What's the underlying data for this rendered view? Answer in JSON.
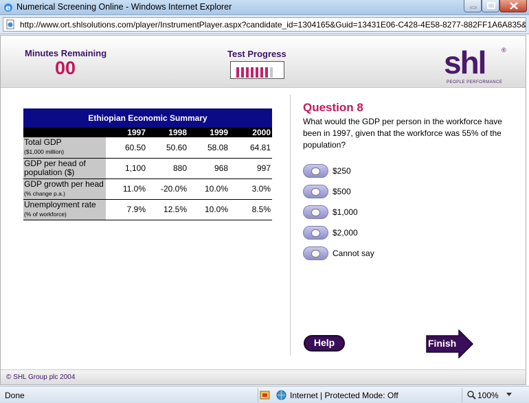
{
  "window": {
    "title": "Numerical Screening Online - Windows Internet Explorer",
    "url": "http://www.ort.shlsolutions.com/player/InstrumentPlayer.aspx?candidate_id=1304165&Guid=13431E06-C428-4E58-8277-882FF1A6A835&"
  },
  "header": {
    "minutes_label": "Minutes Remaining",
    "minutes_value": "00",
    "progress_label": "Test Progress",
    "progress_fraction": 0.875,
    "logo_text": "shl",
    "logo_reg": "®",
    "logo_tagline": "PEOPLE PERFORMANCE"
  },
  "table": {
    "caption": "Ethiopian Economic Summary",
    "years": [
      "1997",
      "1998",
      "1999",
      "2000"
    ],
    "rows": [
      {
        "label_main": "Total GDP",
        "label_sub": "($1,000 million)",
        "values": [
          "60.50",
          "50.60",
          "58.08",
          "64.81"
        ]
      },
      {
        "label_main": "GDP per head of population ($)",
        "label_sub": "",
        "values": [
          "1,100",
          "880",
          "968",
          "997"
        ]
      },
      {
        "label_main": "GDP growth per head",
        "label_sub": "(% change p.a.)",
        "values": [
          "11.0%",
          "-20.0%",
          "10.0%",
          "3.0%"
        ]
      },
      {
        "label_main": "Unemployment rate",
        "label_sub": "(% of workforce)",
        "values": [
          "7.9%",
          "12.5%",
          "10.0%",
          "8.5%"
        ]
      }
    ]
  },
  "question": {
    "title": "Question 8",
    "text": "What would the GDP per person in the workforce have been in 1997, given that the workforce was 55% of the population?",
    "options": [
      "$250",
      "$500",
      "$1,000",
      "$2,000",
      "Cannot say"
    ]
  },
  "buttons": {
    "help": "Help",
    "finish": "Finish"
  },
  "footer": {
    "copyright": "© SHL Group plc 2004"
  },
  "statusbar": {
    "status": "Done",
    "zone": "Internet | Protected Mode: Off",
    "zoom": "100%"
  },
  "colors": {
    "accent_purple": "#3c1466",
    "accent_pink": "#c2185b",
    "table_header_blue": "#0b0b88"
  },
  "icons": [
    "ie-icon",
    "page-icon",
    "minimize-icon",
    "maximize-icon",
    "close-icon",
    "security-icon",
    "globe-icon",
    "zoom-icon"
  ]
}
